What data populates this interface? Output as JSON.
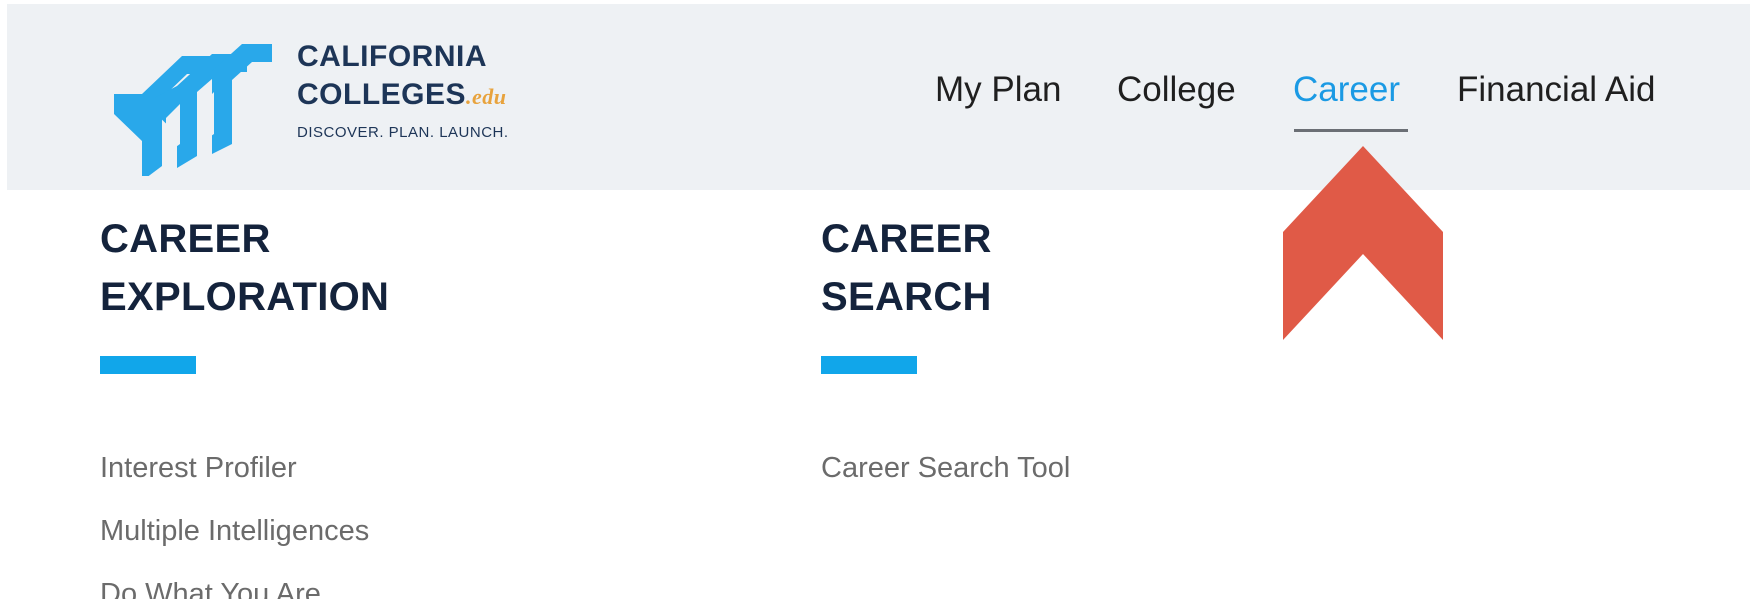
{
  "header": {
    "logo": {
      "line1": "CALIFORNIA",
      "line2": "COLLEGES",
      "suffix": ".edu",
      "tagline": "DISCOVER. PLAN. LAUNCH.",
      "icon": "chevron-stack-logo-icon"
    },
    "nav": [
      {
        "label": "My Plan",
        "active": false
      },
      {
        "label": "College",
        "active": false
      },
      {
        "label": "Career",
        "active": true
      },
      {
        "label": "Financial Aid",
        "active": false
      }
    ]
  },
  "annotation": {
    "icon": "red-up-arrow-icon",
    "color": "#e05a47"
  },
  "menu": {
    "columns": [
      {
        "title_line1": "CAREER",
        "title_line2": "EXPLORATION",
        "links": [
          "Interest Profiler",
          "Multiple Intelligences",
          "Do What You Are"
        ]
      },
      {
        "title_line1": "CAREER",
        "title_line2": "SEARCH",
        "links": [
          "Career Search Tool"
        ]
      }
    ]
  },
  "colors": {
    "accent": "#1b9ae4",
    "bar": "#11a6ea",
    "header_bg": "#eef1f4",
    "title": "#14233c"
  }
}
